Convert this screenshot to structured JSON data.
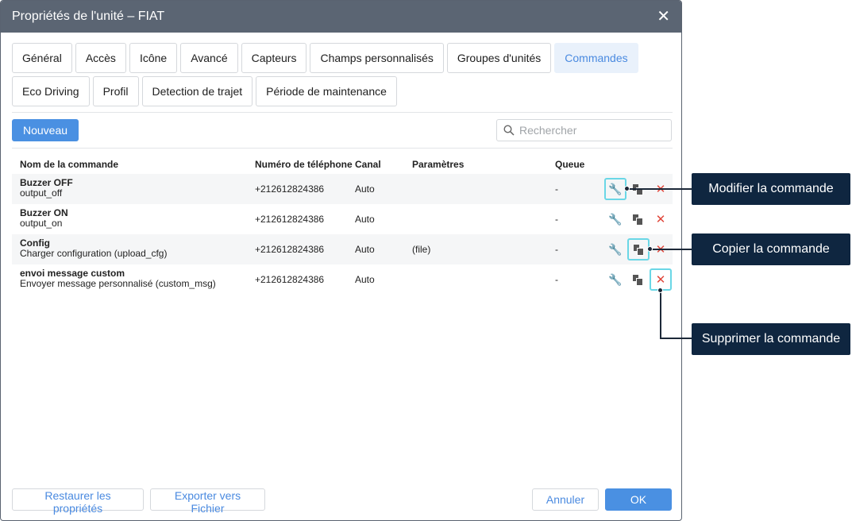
{
  "window": {
    "title": "Propriétés de l'unité – FIAT",
    "close_symbol": "✕"
  },
  "tabs_row1": [
    "Général",
    "Accès",
    "Icône",
    "Avancé",
    "Capteurs",
    "Champs personnalisés",
    "Groupes d'unités",
    "Commandes"
  ],
  "tabs_row2": [
    "Eco Driving",
    "Profil",
    "Detection de trajet",
    "Période de maintenance"
  ],
  "toolbar": {
    "new_label": "Nouveau",
    "search_placeholder": "Rechercher"
  },
  "table": {
    "headers": [
      "Nom de la commande",
      "Numéro de téléphone",
      "Canal",
      "Paramètres",
      "Queue"
    ],
    "rows": [
      {
        "name": "Buzzer OFF",
        "sub": "output_off",
        "phone": "+212612824386",
        "channel": "Auto",
        "params": "",
        "queue": "-"
      },
      {
        "name": "Buzzer ON",
        "sub": "output_on",
        "phone": "+212612824386",
        "channel": "Auto",
        "params": "",
        "queue": "-"
      },
      {
        "name": "Config",
        "sub": "Charger configuration (upload_cfg)",
        "phone": "+212612824386",
        "channel": "Auto",
        "params": "(file)",
        "queue": "-"
      },
      {
        "name": "envoi message custom",
        "sub": "Envoyer message personnalisé (custom_msg)",
        "phone": "+212612824386",
        "channel": "Auto",
        "params": "",
        "queue": "-"
      }
    ]
  },
  "footer": {
    "restore_label": "Restaurer les propriétés",
    "export_label": "Exporter vers Fichier",
    "cancel_label": "Annuler",
    "ok_label": "OK"
  },
  "callouts": {
    "edit": "Modifier la commande",
    "copy": "Copier la commande",
    "delete": "Supprimer la commande"
  },
  "icons": {
    "edit": "wrench-icon",
    "copy": "copy-icon",
    "delete": "delete-icon",
    "search": "search-icon"
  },
  "colors": {
    "accent": "#4a90e2",
    "titlebar": "#5b6573",
    "highlight": "#6ad7e6",
    "callout_bg": "#0f2640",
    "delete": "#e0463a"
  }
}
